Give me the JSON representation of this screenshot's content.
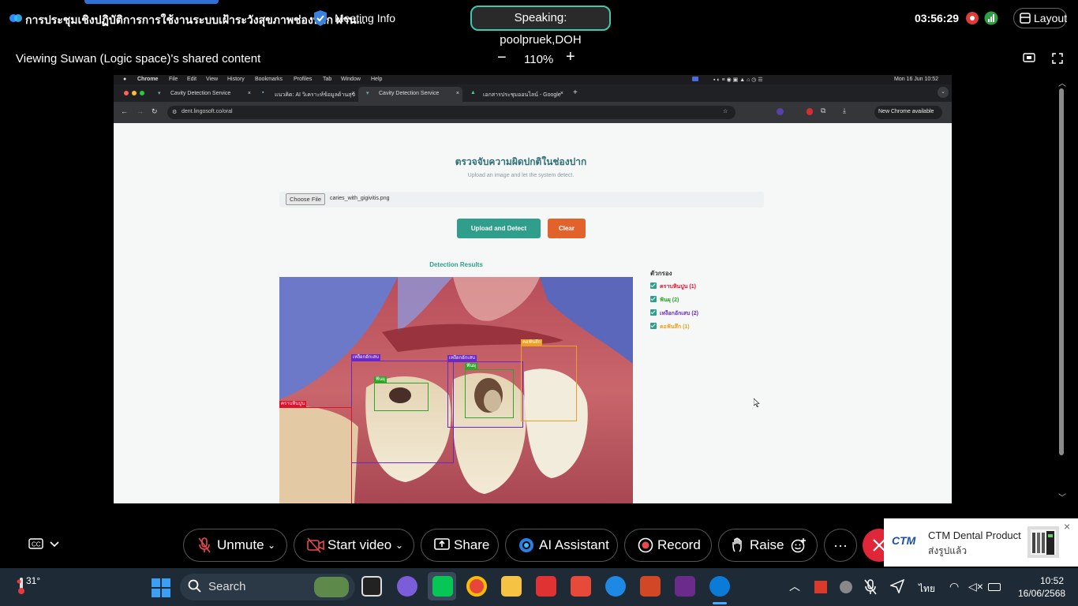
{
  "topbar": {
    "meeting_title": "การประชุมเชิงปฏิบัติการการใช้งานระบบเฝ้าระวังสุขภาพช่องปาก ผ่าน...",
    "meeting_info": "Meeting Info",
    "speaking": "Speaking: poolpruek,DOH",
    "clock": "03:56:29",
    "layout": "Layout"
  },
  "viewing": {
    "label": "Viewing Suwan (Logic space)'s shared content",
    "zoom_minus": "−",
    "zoom": "110%",
    "zoom_plus": "+"
  },
  "shared": {
    "menubar": {
      "app": "Chrome",
      "items": [
        "File",
        "Edit",
        "View",
        "History",
        "Bookmarks",
        "Profiles",
        "Tab",
        "Window",
        "Help"
      ],
      "datetime": "Mon 16 Jun  10:52"
    },
    "tabs": [
      {
        "label": "Cavity Detection Service",
        "active": false
      },
      {
        "label": "แนวคิด: AI วิเคราะห์ข้อมูลด้านสุข",
        "active": false
      },
      {
        "label": "Cavity Detection Service",
        "active": true
      },
      {
        "label": "เอกสารประชุมออนไลน์ - Google",
        "active": false
      }
    ],
    "url": "dent.lingosoft.co/oral",
    "new_chrome": "New Chrome available",
    "page": {
      "title": "ตรวจจับความผิดปกติในช่องปาก",
      "subtitle": "Upload an image and let the system detect.",
      "choose_file": "Choose File",
      "file_name": "caries_with_gigivitis.png",
      "upload_button": "Upload and Detect",
      "clear_button": "Clear",
      "results_title": "Detection Results",
      "filter_title": "ตัวกรอง",
      "filters": [
        {
          "label": "คราบหินปูน (1)",
          "color": "#e0102f"
        },
        {
          "label": "ฟันผุ (2)",
          "color": "#2fa52a"
        },
        {
          "label": "เหงือกอักเสบ (2)",
          "color": "#6a28c8"
        },
        {
          "label": "คอฟันสึก (1)",
          "color": "#f0a020"
        }
      ],
      "boxes": [
        {
          "label": "เหงือกอักเสบ",
          "color": "#6a28c8"
        },
        {
          "label": "เหงือกอักเสบ",
          "color": "#6a28c8"
        },
        {
          "label": "ฟันผุ",
          "color": "#2fa52a"
        },
        {
          "label": "ฟันผุ",
          "color": "#2fa52a"
        },
        {
          "label": "คอฟันสึก",
          "color": "#f0a020"
        },
        {
          "label": "คราบหินปูน",
          "color": "#e0102f"
        }
      ]
    }
  },
  "controls": {
    "unmute": "Unmute",
    "start_video": "Start video",
    "share": "Share",
    "ai_assistant": "AI Assistant",
    "record": "Record",
    "raise": "Raise"
  },
  "notification": {
    "title": "CTM Dental Product",
    "subtitle": "ส่งรูปแล้ว",
    "logo_text": "CTM"
  },
  "taskbar": {
    "weather": "31°",
    "search": "Search",
    "lang": "ไทย",
    "time": "10:52",
    "date": "16/06/2568"
  }
}
